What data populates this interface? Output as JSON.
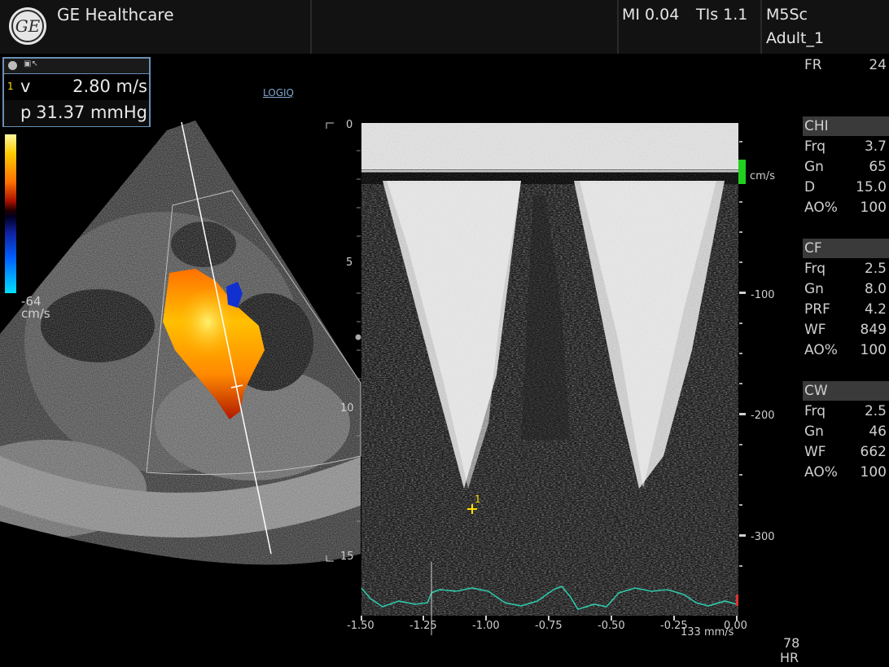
{
  "header": {
    "brand": "GE Healthcare",
    "mi": "MI 0.04",
    "tis": "TIs 1.1",
    "probe": "M5Sc",
    "preset": "Adult_1"
  },
  "measurement": {
    "rows": [
      {
        "index": "1",
        "label": "v",
        "value": "2.80 m/s"
      },
      {
        "index": "",
        "label": "p",
        "value": "31.37 mmHg"
      }
    ]
  },
  "logiq_label": "LOGIQ",
  "color_bar": {
    "negative_label": "-64",
    "unit": "cm/s"
  },
  "two_d_depth_ticks": [
    "0",
    "5",
    "10",
    "15"
  ],
  "doppler": {
    "velocity_unit": "cm/s",
    "velocity_ticks": [
      "-100",
      "-200",
      "-300"
    ],
    "time_ticks": [
      "-1.50",
      "-1.25",
      "-1.00",
      "-0.75",
      "-0.50",
      "-0.25",
      "0.00"
    ],
    "sweep_speed": "133 mm/s",
    "cursor_label": "1"
  },
  "hr": {
    "value": "78",
    "label": "HR"
  },
  "side_panel": {
    "fr": {
      "key": "FR",
      "value": "24"
    },
    "sections": [
      {
        "title": "CHI",
        "rows": [
          {
            "key": "Frq",
            "value": "3.7"
          },
          {
            "key": "Gn",
            "value": "65"
          },
          {
            "key": "D",
            "value": "15.0"
          },
          {
            "key": "AO%",
            "value": "100"
          }
        ]
      },
      {
        "title": "CF",
        "rows": [
          {
            "key": "Frq",
            "value": "2.5"
          },
          {
            "key": "Gn",
            "value": "8.0"
          },
          {
            "key": "PRF",
            "value": "4.2"
          },
          {
            "key": "WF",
            "value": "849"
          },
          {
            "key": "AO%",
            "value": "100"
          }
        ]
      },
      {
        "title": "CW",
        "rows": [
          {
            "key": "Frq",
            "value": "2.5"
          },
          {
            "key": "Gn",
            "value": "46"
          },
          {
            "key": "WF",
            "value": "662"
          },
          {
            "key": "AO%",
            "value": "100"
          }
        ]
      }
    ]
  },
  "colors": {
    "accent_blue": "#6a8fb5",
    "ecg_trace": "#2ec8a8",
    "cursor_yellow": "#ffe000"
  }
}
